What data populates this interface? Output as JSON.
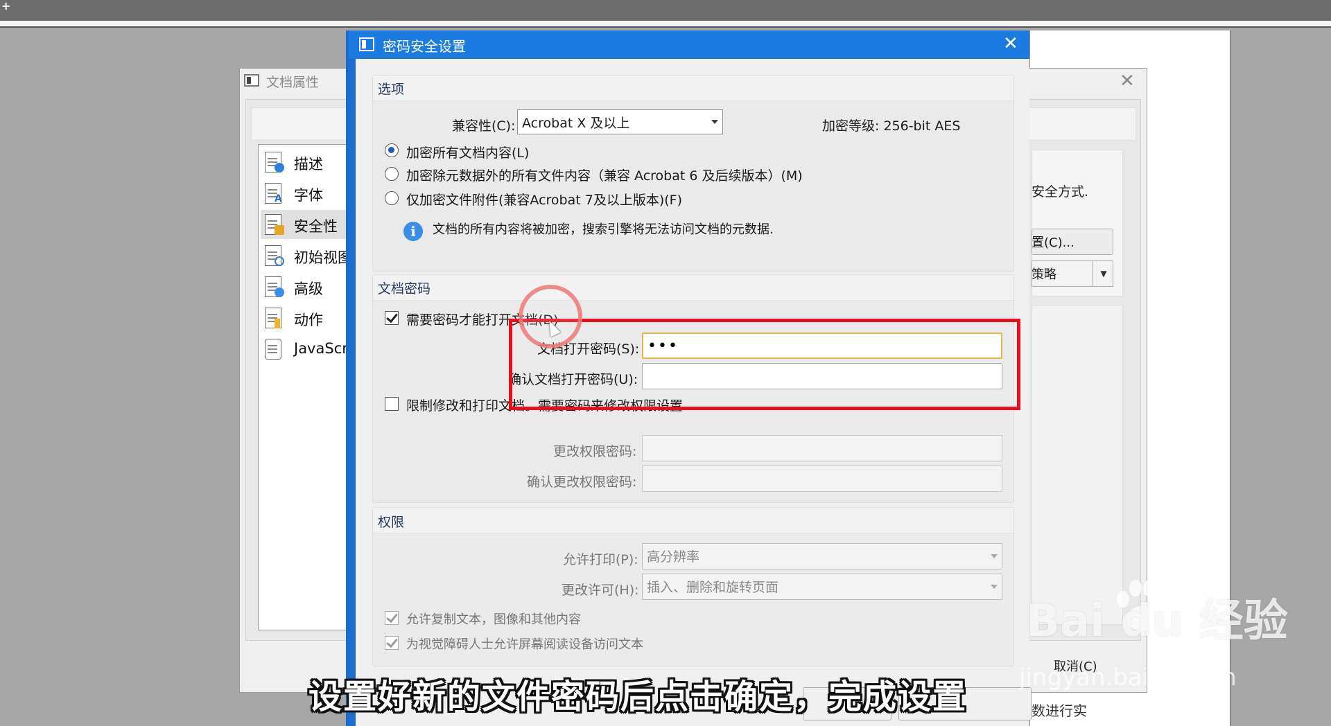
{
  "background": {
    "prop_window": {
      "title": "文档属性",
      "nav_items": [
        {
          "label": "描述",
          "icon": "document-info-icon"
        },
        {
          "label": "字体",
          "icon": "document-font-icon"
        },
        {
          "label": "安全性",
          "icon": "document-lock-icon",
          "selected": true
        },
        {
          "label": "初始视图",
          "icon": "document-view-icon"
        },
        {
          "label": "高级",
          "icon": "document-gear-icon"
        },
        {
          "label": "动作",
          "icon": "document-action-icon"
        },
        {
          "label": "JavaScrip",
          "icon": "script-icon"
        }
      ],
      "right_text": "安全方式.",
      "right_button": "置(C)...",
      "right_select": "策略",
      "cancel_label": "取消(C)",
      "bottom_text": "数进行实"
    }
  },
  "dialog": {
    "title": "密码安全设置",
    "options": {
      "group_title": "选项",
      "compat_label": "兼容性(C):",
      "compat_value": "Acrobat X 及以上",
      "encrypt_level": "加密等级: 256-bit AES",
      "radios": [
        {
          "label": "加密所有文档内容(L)",
          "checked": true
        },
        {
          "label": "加密除元数据外的所有文件内容（兼容 Acrobat 6 及后续版本）(M)",
          "checked": false
        },
        {
          "label": "仅加密文件附件(兼容Acrobat 7及以上版本)(F)",
          "checked": false
        }
      ],
      "info_text": "文档的所有内容将被加密，搜索引擎将无法访问文档的元数据."
    },
    "doc_password": {
      "group_title": "文档密码",
      "require_label": "需要密码才能打开文档(D)",
      "require_checked": true,
      "open_pw_label": "文档打开密码(S):",
      "open_pw_value": "•••",
      "confirm_pw_label": "确认文档打开密码(U):",
      "confirm_pw_value": "",
      "restrict_label": "限制修改和打印文档。需要密码来修改权限设置",
      "restrict_checked": false,
      "perm_pw_label": "更改权限密码:",
      "confirm_perm_pw_label": "确认更改权限密码:"
    },
    "permissions": {
      "group_title": "权限",
      "print_label": "允许打印(P):",
      "print_value": "高分辨率",
      "change_label": "更改许可(H):",
      "change_value": "插入、删除和旋转页面",
      "copy_label": "允许复制文本，图像和其他内容",
      "copy_checked": true,
      "reader_label": "为视觉障碍人士允许屏幕阅读设备访问文本",
      "reader_checked": true
    }
  },
  "caption": "设置好新的文件密码后点击确定，完成设置",
  "watermark": {
    "brand": "Bai du 经验",
    "url": "jingyan.baidu.com"
  },
  "colors": {
    "titlebar": "#1c7be0",
    "highlight": "#e8101a",
    "focus_border": "#e5b64a"
  }
}
